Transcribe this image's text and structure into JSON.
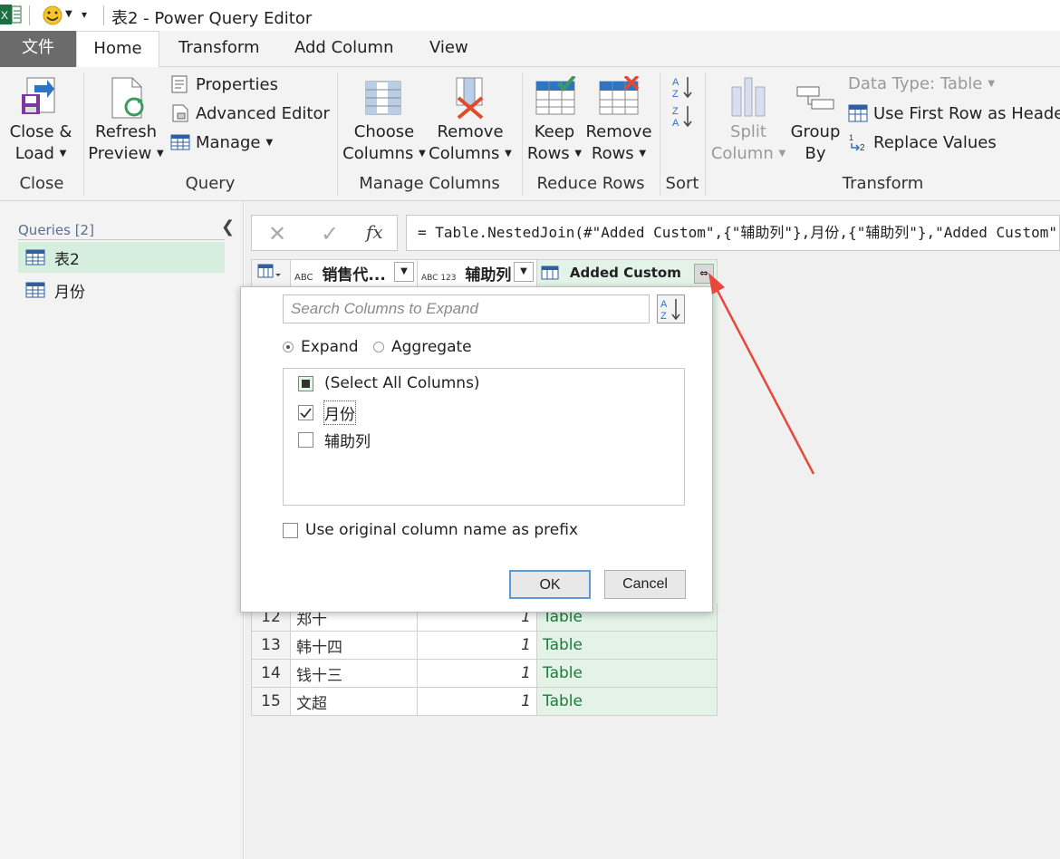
{
  "window": {
    "title": "表2 - Power Query Editor"
  },
  "tabs": [
    "文件",
    "Home",
    "Transform",
    "Add Column",
    "View"
  ],
  "ribbon": {
    "close_load": [
      "Close &",
      "Load"
    ],
    "refresh_preview": [
      "Refresh",
      "Preview"
    ],
    "properties": "Properties",
    "advanced_editor": "Advanced Editor",
    "manage": "Manage",
    "choose_columns": [
      "Choose",
      "Columns"
    ],
    "remove_columns": [
      "Remove",
      "Columns"
    ],
    "keep_rows": [
      "Keep",
      "Rows"
    ],
    "remove_rows": [
      "Remove",
      "Rows"
    ],
    "split_column": [
      "Split",
      "Column"
    ],
    "group_by": [
      "Group",
      "By"
    ],
    "data_type": "Data Type: Table",
    "use_first_row": "Use First Row as Headers",
    "replace_values": "Replace Values",
    "groups": [
      "Close",
      "Query",
      "Manage Columns",
      "Reduce Rows",
      "Sort",
      "Transform"
    ]
  },
  "queries": {
    "label": "Queries [2]",
    "items": [
      "表2",
      "月份"
    ]
  },
  "formula": "= Table.NestedJoin(#\"Added Custom\",{\"辅助列\"},月份,{\"辅助列\"},\"Added Custom\",JoinKind.LeftOuter)",
  "grid": {
    "headers": [
      "销售代...",
      "辅助列",
      "Added Custom"
    ],
    "header_types": [
      "ABC",
      "ABC 123"
    ],
    "rows": [
      {
        "num": "12",
        "name": "郑十",
        "val": "1",
        "tbl": "Table"
      },
      {
        "num": "13",
        "name": "韩十四",
        "val": "1",
        "tbl": "Table"
      },
      {
        "num": "14",
        "name": "钱十三",
        "val": "1",
        "tbl": "Table"
      },
      {
        "num": "15",
        "name": "文超",
        "val": "1",
        "tbl": "Table"
      }
    ]
  },
  "popup": {
    "search_placeholder": "Search Columns to Expand",
    "expand": "Expand",
    "aggregate": "Aggregate",
    "columns": [
      "(Select All Columns)",
      "月份",
      "辅助列"
    ],
    "prefix": "Use original column name as prefix",
    "ok": "OK",
    "cancel": "Cancel"
  },
  "colors": {
    "accent_green": "#217346",
    "table_green": "#e3f3e8",
    "arrow_red": "#e8473a"
  }
}
